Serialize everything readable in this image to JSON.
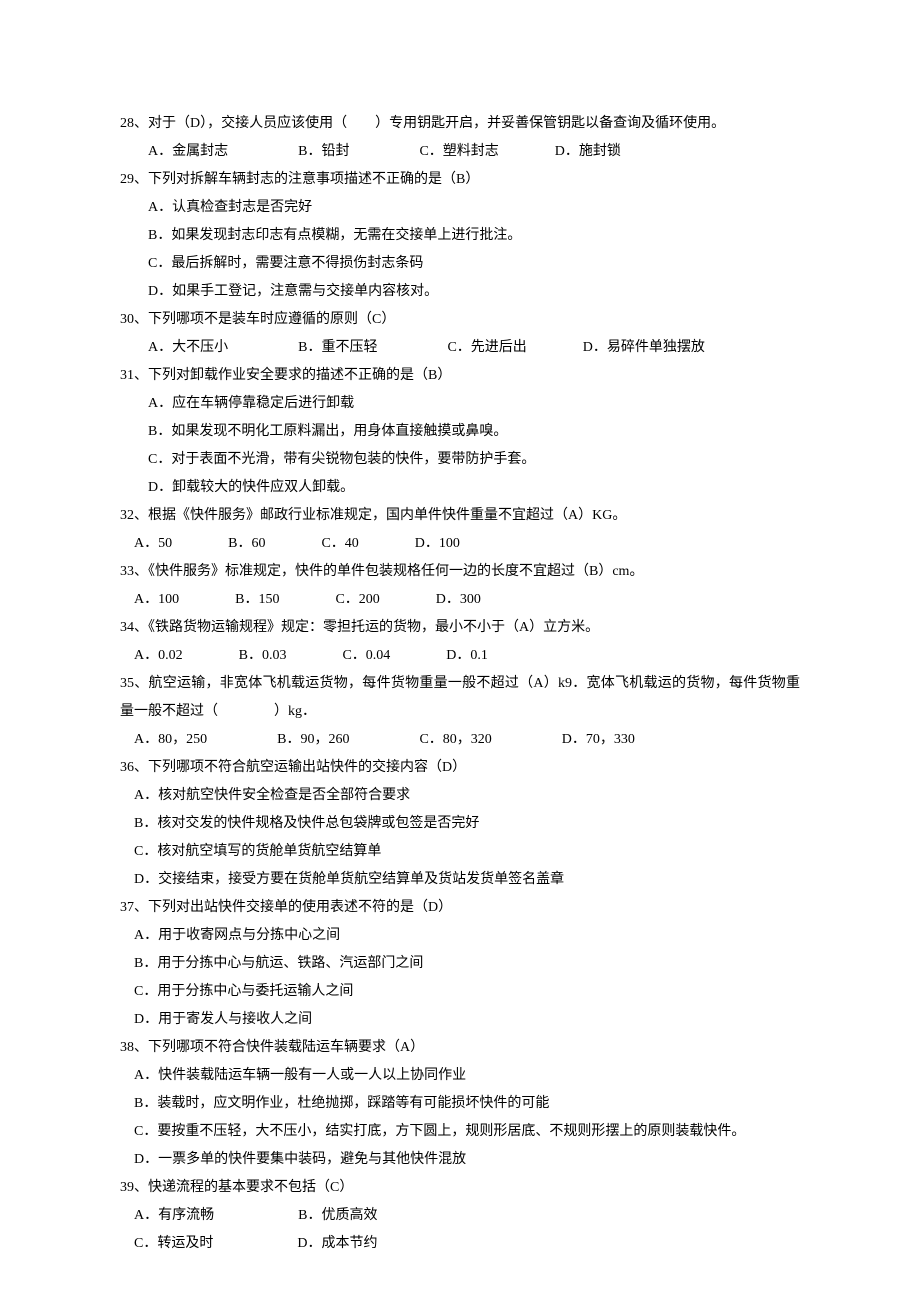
{
  "questions": [
    {
      "num": "28、",
      "text": "对于（D），交接人员应该使用（　　）专用钥匙开启，并妥善保管钥匙以备查询及循环使用。",
      "options": [
        "A．金属封志　　　　　B．铅封　　　　　C．塑料封志　　　　D．施封锁"
      ],
      "subIndent": false
    },
    {
      "num": "29、",
      "text": "下列对拆解车辆封志的注意事项描述不正确的是（B）",
      "options": [
        "A．认真检查封志是否完好",
        "B．如果发现封志印志有点模糊，无需在交接单上进行批注。",
        "C．最后拆解时，需要注意不得损伤封志条码",
        "D．如果手工登记，注意需与交接单内容核对。"
      ],
      "subIndent": false
    },
    {
      "num": "30、",
      "text": "下列哪项不是装车时应遵循的原则（C）",
      "options": [
        "A．大不压小　　　　　B．重不压轻　　　　　C．先进后出　　　　D．易碎件单独摆放"
      ],
      "subIndent": false
    },
    {
      "num": "31、",
      "text": "下列对卸载作业安全要求的描述不正确的是（B）",
      "options": [
        "A．应在车辆停靠稳定后进行卸载",
        "B．如果发现不明化工原料漏出，用身体直接触摸或鼻嗅。",
        "C．对于表面不光滑，带有尖锐物包装的快件，要带防护手套。",
        "D．卸载较大的快件应双人卸载。"
      ],
      "subIndent": false
    },
    {
      "num": "32、",
      "text": "根据《快件服务》邮政行业标准规定，国内单件快件重量不宜超过（A）KG。",
      "options": [
        "A．50　　　　B．60　　　　C．40　　　　D．100"
      ],
      "subIndent": true
    },
    {
      "num": "33、",
      "text": "《快件服务》标准规定，快件的单件包装规格任何一边的长度不宜超过（B）cm。",
      "options": [
        "A．100　　　　B．150　　　　C．200　　　　D．300"
      ],
      "subIndent": true
    },
    {
      "num": "34、",
      "text": "《铁路货物运输规程》规定：零担托运的货物，最小不小于（A）立方米。",
      "options": [
        "A．0.02　　　　B．0.03　　　　C．0.04　　　　D．0.1"
      ],
      "subIndent": true
    },
    {
      "num": "35、",
      "text": "航空运输，非宽体飞机载运货物，每件货物重量一般不超过（A）k9．宽体飞机载运的货物，每件货物重量一般不超过（　　　　）kg．",
      "options": [
        "A．80，250　　　　　B．90，260　　　　　C．80，320　　　　　D．70，330"
      ],
      "subIndent": true,
      "multiline": true
    },
    {
      "num": "36、",
      "text": "下列哪项不符合航空运输出站快件的交接内容（D）",
      "options": [
        "A．核对航空快件安全检查是否全部符合要求",
        "B．核对交发的快件规格及快件总包袋牌或包签是否完好",
        "C．核对航空填写的货舱单货航空结算单",
        "D．交接结束，接受方要在货舱单货航空结算单及货站发货单签名盖章"
      ],
      "subIndent": true
    },
    {
      "num": "37、",
      "text": "下列对出站快件交接单的使用表述不符的是（D）",
      "options": [
        "A．用于收寄网点与分拣中心之间",
        "B．用于分拣中心与航运、铁路、汽运部门之间",
        "C．用于分拣中心与委托运输人之间",
        "D．用于寄发人与接收人之间"
      ],
      "subIndent": true
    },
    {
      "num": "38、",
      "text": "下列哪项不符合快件装载陆运车辆要求（A）",
      "options": [
        "A．快件装载陆运车辆一般有一人或一人以上协同作业",
        "B．装载时，应文明作业，杜绝抛掷，踩踏等有可能损坏快件的可能",
        "C．要按重不压轻，大不压小，结实打底，方下圆上，规则形居底、不规则形摆上的原则装载快件。",
        "D．一票多单的快件要集中装码，避免与其他快件混放"
      ],
      "subIndent": true
    },
    {
      "num": "39、",
      "text": "快递流程的基本要求不包括（C）",
      "options": [
        "A．有序流畅　　　　　　B．优质高效",
        "C．转运及时　　　　　　D．成本节约"
      ],
      "subIndent": true
    }
  ]
}
